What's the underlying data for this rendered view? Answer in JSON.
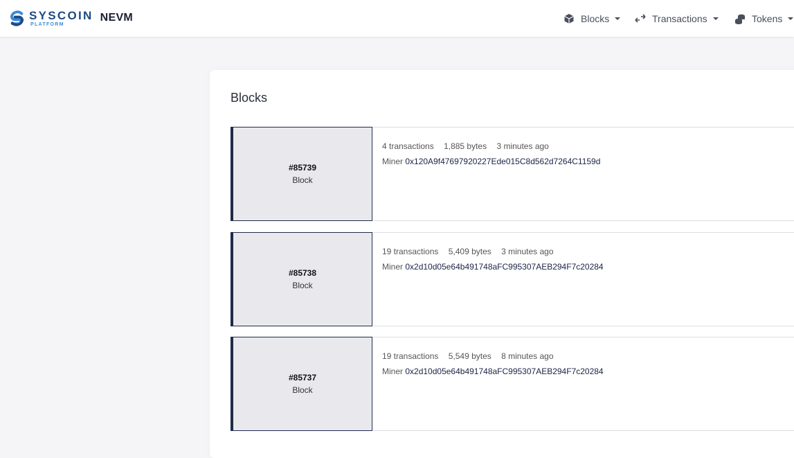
{
  "header": {
    "logo_word": "SYSCOIN",
    "logo_sub": "PLATFORM",
    "network": "NEVM",
    "nav": [
      {
        "label": "Blocks",
        "icon": "cube-icon"
      },
      {
        "label": "Transactions",
        "icon": "arrows-icon"
      },
      {
        "label": "Tokens",
        "icon": "coins-icon"
      }
    ]
  },
  "main": {
    "title": "Blocks",
    "blocks": [
      {
        "number": "#85739",
        "label": "Block",
        "transactions": "4 transactions",
        "size": "1,885 bytes",
        "age": "3 minutes ago",
        "miner_label": "Miner",
        "miner": "0x120A9f47697920227Ede015C8d562d7264C1159d"
      },
      {
        "number": "#85738",
        "label": "Block",
        "transactions": "19 transactions",
        "size": "5,409 bytes",
        "age": "3 minutes ago",
        "miner_label": "Miner",
        "miner": "0x2d10d05e64b491748aFC995307AEB294F7c20284"
      },
      {
        "number": "#85737",
        "label": "Block",
        "transactions": "19 transactions",
        "size": "5,549 bytes",
        "age": "8 minutes ago",
        "miner_label": "Miner",
        "miner": "0x2d10d05e64b491748aFC995307AEB294F7c20284"
      }
    ]
  },
  "colors": {
    "brand": "#1e4a86",
    "accent": "#3a8ad6",
    "tile_border": "#1e2a4a",
    "tile_bg": "#e9e9ed"
  }
}
